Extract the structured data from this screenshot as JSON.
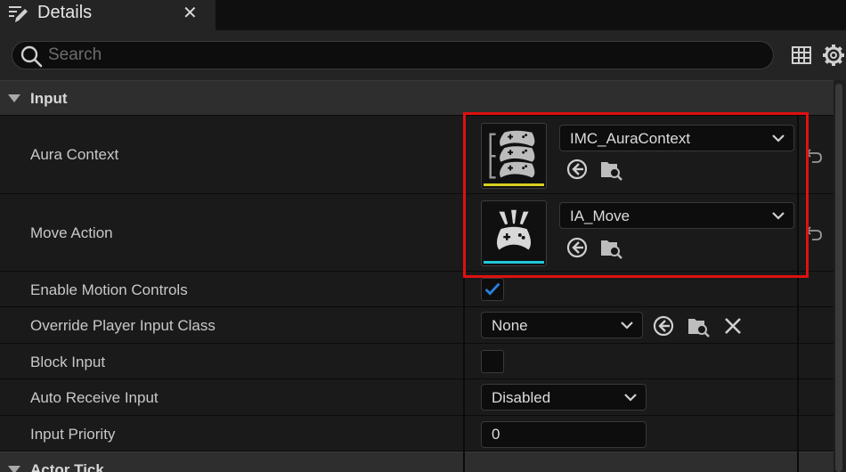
{
  "tab": {
    "title": "Details"
  },
  "search": {
    "placeholder": "Search"
  },
  "sections": [
    {
      "label": "Input"
    },
    {
      "label": "Actor Tick"
    }
  ],
  "rows": {
    "aura_context": {
      "label": "Aura Context",
      "value": "IMC_AuraContext",
      "thumb_icon": "input-mapping-context-icon",
      "accent": "#d8d020"
    },
    "move_action": {
      "label": "Move Action",
      "value": "IA_Move",
      "thumb_icon": "input-action-icon",
      "accent": "#20c8d8"
    },
    "enable_motion_controls": {
      "label": "Enable Motion Controls",
      "checked": true
    },
    "override_player_input_class": {
      "label": "Override Player Input Class",
      "value": "None"
    },
    "block_input": {
      "label": "Block Input",
      "checked": false
    },
    "auto_receive_input": {
      "label": "Auto Receive Input",
      "value": "Disabled"
    },
    "input_priority": {
      "label": "Input Priority",
      "value": "0"
    }
  },
  "colors": {
    "highlight": "#e01010",
    "check": "#2a7fe0"
  }
}
